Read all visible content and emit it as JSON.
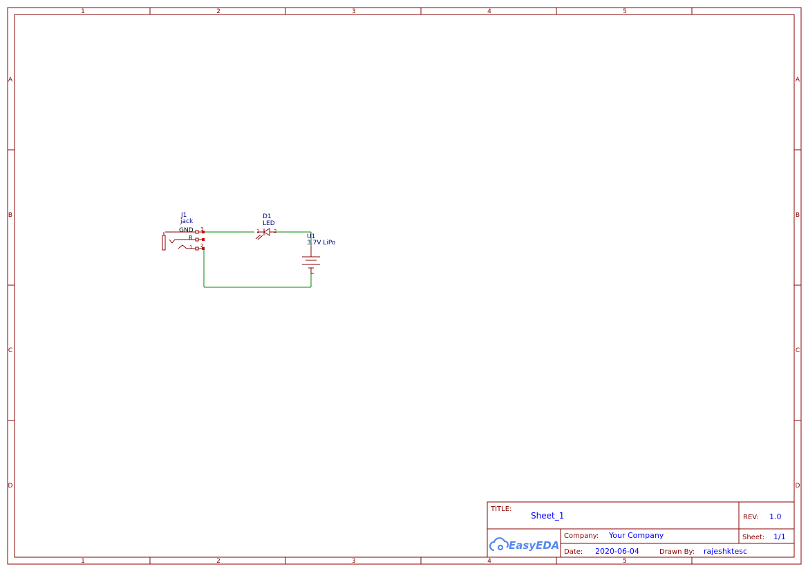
{
  "colors": {
    "frame": "#880000",
    "wire": "#008800",
    "designator": "#000080",
    "pin_text": "#880000",
    "value_text": "#0000ff",
    "tb_label": "#880000",
    "tb_value": "#0000ff",
    "logo": "#5588ee"
  },
  "frame": {
    "columns": [
      "1",
      "2",
      "3",
      "4",
      "5"
    ],
    "rows": [
      "A",
      "B",
      "C",
      "D"
    ]
  },
  "components": {
    "jack": {
      "ref": "J1",
      "name": "jack",
      "pin_gnd": "GND",
      "pin_r": "R",
      "pin_num_3": "3",
      "pin_num_1": "1",
      "pin_num_2": "2"
    },
    "led": {
      "ref": "D1",
      "name": "LED",
      "pin_1": "1",
      "pin_2": "2"
    },
    "battery": {
      "ref": "U1",
      "name": "3.7V LiPo"
    }
  },
  "title_block": {
    "title_label": "TITLE:",
    "title_value": "Sheet_1",
    "rev_label": "REV:",
    "rev_value": "1.0",
    "company_label": "Company:",
    "company_value": "Your Company",
    "sheet_label": "Sheet:",
    "sheet_value": "1/1",
    "date_label": "Date:",
    "date_value": "2020-06-04",
    "drawn_label": "Drawn By:",
    "drawn_value": "rajeshktesc",
    "logo_text": "EasyEDA"
  }
}
